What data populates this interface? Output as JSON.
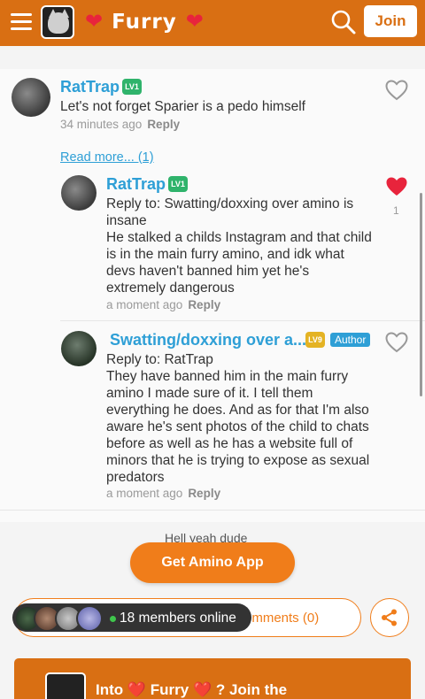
{
  "header": {
    "community_title": "Furry",
    "heart_left": "❤️",
    "heart_right": "❤️",
    "join_label": "Join"
  },
  "comments": [
    {
      "username": "RatTrap",
      "level": "LV1",
      "text": "Let's not forget Sparier is a pedo himself",
      "time": "34 minutes ago",
      "reply_label": "Reply"
    }
  ],
  "read_more": "Read more... (1)",
  "replies": [
    {
      "username": "RatTrap",
      "level": "LV1",
      "reply_to": "Reply to: Swatting/doxxing over amino is insane",
      "text": "He stalked a childs  Instagram and that child is in the main furry amino, and idk what devs haven't banned him yet he's extremely dangerous",
      "time": "a moment ago",
      "reply_label": "Reply",
      "likes": "1"
    },
    {
      "username": "Swatting/doxxing over a...",
      "level": "LV9",
      "badge": "Author",
      "reply_to": "Reply to: RatTrap",
      "text": "They have banned him in the main furry amino I made sure of it. I tell them everything he does. And as for that I'm also aware he's sent photos of the child to chats before as well as he has a website full of minors that he is trying to expose as sexual predators",
      "time": "a moment ago",
      "reply_label": "Reply"
    }
  ],
  "partial_comment": "Hell yeah dude",
  "get_app_label": "Get Amino App",
  "comments_label": "omments (0)",
  "online_text": "18 members online",
  "banner_text": "Into ❤️ Furry ❤️ ? Join the",
  "colors": {
    "brand_orange": "#d96f13",
    "button_orange": "#f07d1a",
    "link_blue": "#2e9fd6",
    "like_red": "#e8243c"
  }
}
